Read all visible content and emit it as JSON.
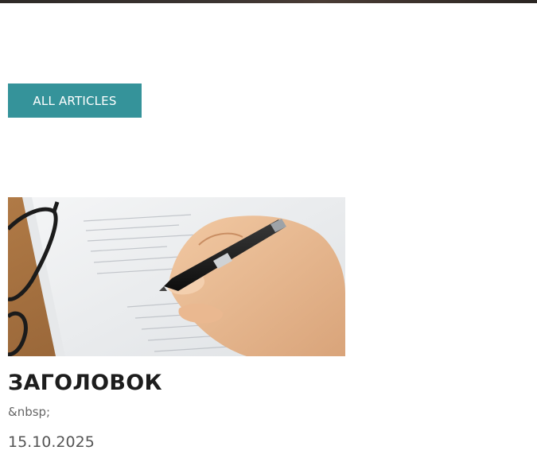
{
  "header": {
    "hero_strip": "hero image bottom edge"
  },
  "actions": {
    "all_articles_label": "ALL ARTICLES"
  },
  "article": {
    "image_alt": "hand signing a document with a pen",
    "title": "ЗАГОЛОВОК",
    "excerpt": "&nbsp;",
    "date": "15.10.2025"
  },
  "colors": {
    "accent": "#35939a",
    "title_text": "#1d1d1d",
    "muted_text": "#666666"
  }
}
